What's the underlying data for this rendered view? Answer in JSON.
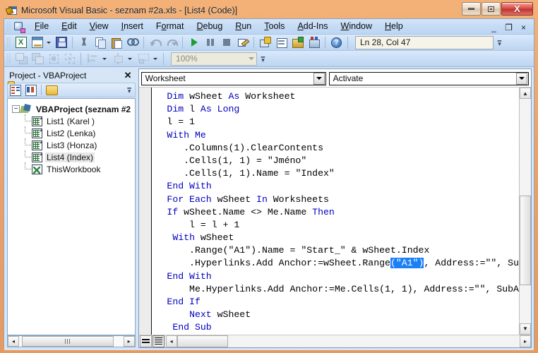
{
  "window": {
    "title": "Microsoft Visual Basic - seznam #2a.xls - [List4 (Code)]",
    "title_icon": "vb-excel-icon",
    "minimize_label": "",
    "restore_label": "",
    "close_label": "X"
  },
  "mdi": {
    "minimize": "_",
    "restore": "❐",
    "close": "×"
  },
  "menu": {
    "items": [
      {
        "label": "File",
        "accel": "F"
      },
      {
        "label": "Edit",
        "accel": "E"
      },
      {
        "label": "View",
        "accel": "V"
      },
      {
        "label": "Insert",
        "accel": "I"
      },
      {
        "label": "Format",
        "accel": "o"
      },
      {
        "label": "Debug",
        "accel": "D"
      },
      {
        "label": "Run",
        "accel": "R"
      },
      {
        "label": "Tools",
        "accel": "T"
      },
      {
        "label": "Add-Ins",
        "accel": "A"
      },
      {
        "label": "Window",
        "accel": "W"
      },
      {
        "label": "Help",
        "accel": "H"
      }
    ]
  },
  "toolbar_standard": {
    "buttons": [
      {
        "name": "view-excel-icon",
        "tooltip": "View Microsoft Excel"
      },
      {
        "name": "insert-userform-icon",
        "tooltip": "Insert UserForm",
        "has_dropdown": true
      },
      {
        "name": "save-icon",
        "tooltip": "Save seznam #2a.xls"
      },
      {
        "name": "cut-icon",
        "tooltip": "Cut"
      },
      {
        "name": "copy-icon",
        "tooltip": "Copy"
      },
      {
        "name": "paste-icon",
        "tooltip": "Paste"
      },
      {
        "name": "find-icon",
        "tooltip": "Find"
      },
      {
        "name": "undo-icon",
        "tooltip": "Undo",
        "disabled": true
      },
      {
        "name": "redo-icon",
        "tooltip": "Redo",
        "disabled": true
      },
      {
        "name": "run-icon",
        "tooltip": "Run Sub/UserForm"
      },
      {
        "name": "pause-icon",
        "tooltip": "Break"
      },
      {
        "name": "stop-icon",
        "tooltip": "Reset"
      },
      {
        "name": "design-mode-icon",
        "tooltip": "Design Mode"
      },
      {
        "name": "project-explorer-icon",
        "tooltip": "Project Explorer"
      },
      {
        "name": "properties-window-icon",
        "tooltip": "Properties Window"
      },
      {
        "name": "object-browser-icon",
        "tooltip": "Object Browser"
      },
      {
        "name": "toolbox-icon",
        "tooltip": "Toolbox"
      },
      {
        "name": "help-icon",
        "tooltip": "Microsoft Visual Basic Help"
      }
    ],
    "position_field": "Ln 28, Col 47",
    "overflow": "»"
  },
  "toolbar_edit": {
    "buttons": [
      {
        "name": "bring-to-front-icon"
      },
      {
        "name": "send-to-back-icon"
      },
      {
        "name": "group-icon"
      },
      {
        "name": "ungroup-icon"
      },
      {
        "name": "align-icon",
        "has_dropdown": true
      },
      {
        "name": "center-icon",
        "has_dropdown": true
      },
      {
        "name": "make-same-size-icon",
        "has_dropdown": true
      }
    ],
    "zoom_value": "100%",
    "overflow": "»"
  },
  "project_explorer": {
    "title": "Project - VBAProject",
    "close_label": "✕",
    "toolbar": [
      {
        "name": "view-code-icon"
      },
      {
        "name": "view-object-icon"
      },
      {
        "name": "toggle-folders-icon"
      }
    ],
    "tree": [
      {
        "label": "VBAProject (seznam #2",
        "icon": "vba-project-icon",
        "level": 0,
        "bold": true,
        "expanded": true,
        "selected": false
      },
      {
        "label": "List1 (Karel )",
        "icon": "worksheet-icon",
        "level": 1,
        "bold": false,
        "selected": false
      },
      {
        "label": "List2 (Lenka)",
        "icon": "worksheet-icon",
        "level": 1,
        "bold": false,
        "selected": false
      },
      {
        "label": "List3 (Honza)",
        "icon": "worksheet-icon",
        "level": 1,
        "bold": false,
        "selected": false
      },
      {
        "label": "List4 (Index)",
        "icon": "worksheet-icon",
        "level": 1,
        "bold": false,
        "selected": true
      },
      {
        "label": "ThisWorkbook",
        "icon": "workbook-icon",
        "level": 1,
        "bold": false,
        "selected": false
      }
    ],
    "expander_collapse": "−"
  },
  "code_window": {
    "object_dropdown": "Worksheet",
    "procedure_dropdown": "Activate",
    "view_buttons": [
      {
        "name": "procedure-view-button",
        "active": false
      },
      {
        "name": "full-module-view-button",
        "active": true
      }
    ],
    "lines": [
      [
        {
          "t": "  ",
          "s": "cd"
        },
        {
          "t": "Dim",
          "s": "kw"
        },
        {
          "t": " wSheet ",
          "s": "cd"
        },
        {
          "t": "As",
          "s": "kw"
        },
        {
          "t": " Worksheet",
          "s": "cd"
        }
      ],
      [
        {
          "t": "  ",
          "s": "cd"
        },
        {
          "t": "Dim",
          "s": "kw"
        },
        {
          "t": " l ",
          "s": "cd"
        },
        {
          "t": "As",
          "s": "kw"
        },
        {
          "t": " ",
          "s": "cd"
        },
        {
          "t": "Long",
          "s": "kw"
        }
      ],
      [
        {
          "t": "  l = 1",
          "s": "cd"
        }
      ],
      [
        {
          "t": "  ",
          "s": "cd"
        },
        {
          "t": "With",
          "s": "kw"
        },
        {
          "t": " ",
          "s": "cd"
        },
        {
          "t": "Me",
          "s": "kw"
        }
      ],
      [
        {
          "t": "     .Columns(1).ClearContents",
          "s": "cd"
        }
      ],
      [
        {
          "t": "     .Cells(1, 1) = ",
          "s": "cd"
        },
        {
          "t": "\"Jméno\"",
          "s": "cd"
        }
      ],
      [
        {
          "t": "     .Cells(1, 1).Name = ",
          "s": "cd"
        },
        {
          "t": "\"Index\"",
          "s": "cd"
        }
      ],
      [
        {
          "t": "  ",
          "s": "cd"
        },
        {
          "t": "End With",
          "s": "kw"
        }
      ],
      [
        {
          "t": "  ",
          "s": "cd"
        },
        {
          "t": "For Each",
          "s": "kw"
        },
        {
          "t": " wSheet ",
          "s": "cd"
        },
        {
          "t": "In",
          "s": "kw"
        },
        {
          "t": " Worksheets",
          "s": "cd"
        }
      ],
      [
        {
          "t": "  ",
          "s": "cd"
        },
        {
          "t": "If",
          "s": "kw"
        },
        {
          "t": " wSheet.Name <> Me.Name ",
          "s": "cd"
        },
        {
          "t": "Then",
          "s": "kw"
        }
      ],
      [
        {
          "t": "      l = l + 1",
          "s": "cd"
        }
      ],
      [
        {
          "t": "   ",
          "s": "cd"
        },
        {
          "t": "With",
          "s": "kw"
        },
        {
          "t": " wSheet",
          "s": "cd"
        }
      ],
      [
        {
          "t": "      .Range(\"A1\").Name = \"Start_\" & wSheet.Index",
          "s": "cd"
        }
      ],
      [
        {
          "t": "      .Hyperlinks.Add Anchor:=wSheet.Range",
          "s": "cd"
        },
        {
          "t": "(\"A1\")",
          "s": "sel"
        },
        {
          "t": ", Address:=\"\", Su",
          "s": "cd"
        }
      ],
      [
        {
          "t": "  ",
          "s": "cd"
        },
        {
          "t": "End With",
          "s": "kw"
        }
      ],
      [
        {
          "t": "      Me.Hyperlinks.Add Anchor:=Me.Cells(1, 1), Address:=\"\", SubA",
          "s": "cd"
        }
      ],
      [
        {
          "t": "  ",
          "s": "cd"
        },
        {
          "t": "End If",
          "s": "kw"
        }
      ],
      [
        {
          "t": "      ",
          "s": "cd"
        },
        {
          "t": "Next",
          "s": "kw"
        },
        {
          "t": " wSheet",
          "s": "cd"
        }
      ],
      [
        {
          "t": "   ",
          "s": "cd"
        },
        {
          "t": "End Sub",
          "s": "kw"
        }
      ]
    ]
  },
  "colors": {
    "frame": "#e8a866",
    "client": "#d6e6f7",
    "toolbar_top": "#dbeafc",
    "keyword": "#0000c0",
    "code": "#000000",
    "selection_bg": "#1b7ff7",
    "selection_fg": "#ffffff",
    "tree_selection": "#e8e8e8",
    "close_button": "#c0332c"
  }
}
